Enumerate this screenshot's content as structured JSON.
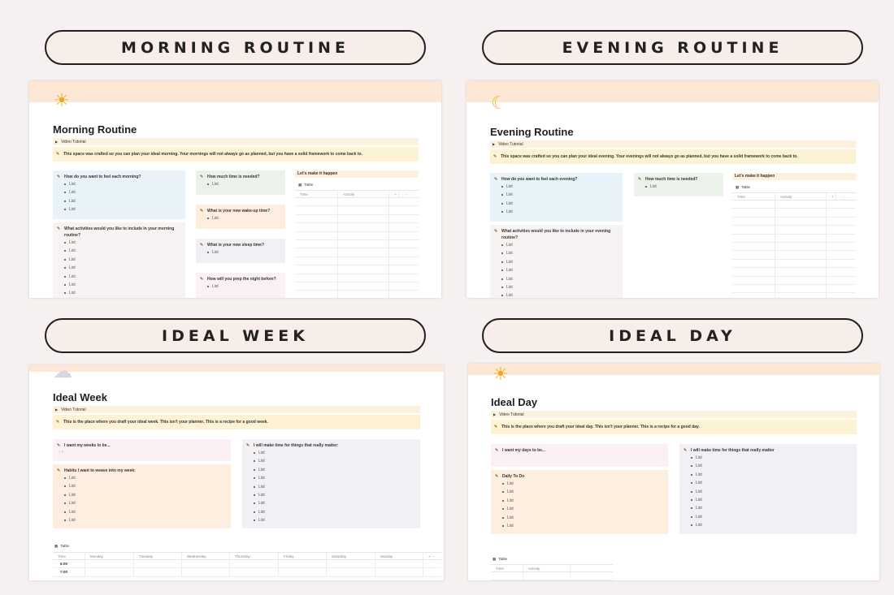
{
  "headers": {
    "morning": "MORNING ROUTINE",
    "evening": "EVENING ROUTINE",
    "week": "IDEAL WEEK",
    "day": "IDEAL DAY"
  },
  "morning": {
    "icon": "sun-icon",
    "title": "Morning Routine",
    "video": "Video Tutorial",
    "callout": "This space was crafted so you can plan your ideal morning. Your mornings will not always go as planned, but you have a solid framework to come back to.",
    "q_feel": "How do you want to feel each morning?",
    "q_activities": "What activities would you like to include in your morning routine?",
    "q_time": "How much time is needed?",
    "q_wake": "What is your new wake-up time?",
    "q_sleep": "What is your new sleep time?",
    "q_prep": "How will you prep the night before?",
    "list_item": "List",
    "make_it": "Let's make it happen",
    "table_label": "Table",
    "col_time": "Time",
    "col_activity": "Activity",
    "col_add": "+",
    "col_more": "···"
  },
  "evening": {
    "icon": "moon-icon",
    "title": "Evening Routine",
    "video": "Video Tutorial",
    "callout": "This space was crafted so you can plan your ideal evening. Your evenings will not always go as planned, but you have a solid framework to come back to.",
    "q_feel": "How do you want to feel each evening?",
    "q_activities": "What activities would you like to include in your evening routine?",
    "q_time": "How much time is needed?",
    "list_item": "List",
    "make_it": "Let's make it happen",
    "table_label": "Table",
    "col_time": "Time",
    "col_activity": "Activity",
    "col_add": "+",
    "col_more": "···"
  },
  "week": {
    "icon": "cloud-icon",
    "title": "Ideal Week",
    "video": "Video Tutorial",
    "callout": "This is the place where you draft your ideal week. This isn't your planner. This is a recipe for a good week.",
    "q_want": "I want my weeks to be...",
    "q_habits": "Habits I want to weave into my week:",
    "q_make_time": "I will make time for things that really matter:",
    "list_item": "List",
    "table_label": "Table",
    "days": [
      "Time",
      "Monday",
      "Tuesday",
      "Wednesday",
      "Thursday",
      "Friday",
      "Saturday",
      "Sunday"
    ],
    "times": [
      "6:00",
      "7:00"
    ]
  },
  "day": {
    "icon": "sun-icon",
    "title": "Ideal Day",
    "video": "Video Tutorial",
    "callout": "This is the place where you draft your ideal day. This isn't your planner. This is a recipe for a good day.",
    "q_want": "I want my days to be...",
    "q_todo": "Daily To Do",
    "q_make_time": "I will make time for things that really matter",
    "list_item": "List",
    "table_label": "Table",
    "col_time": "Time",
    "col_activity": "Activity"
  }
}
